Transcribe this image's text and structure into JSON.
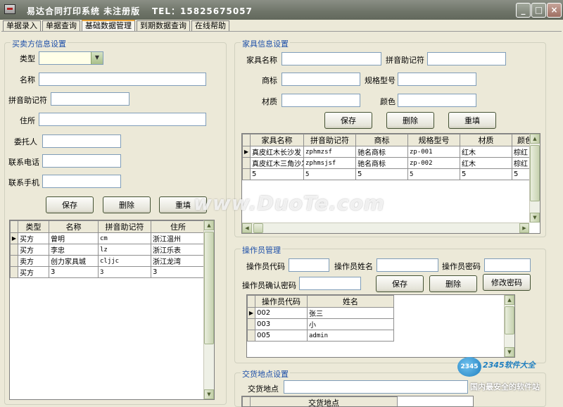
{
  "window": {
    "title": "易达合同打印系统 未注册版",
    "tel": "TEL：15825675057",
    "minimize_glyph": "_",
    "maximize_glyph": "□",
    "close_glyph": "×"
  },
  "tabs": [
    {
      "label": "单据录入",
      "active": false
    },
    {
      "label": "单据查询",
      "active": false
    },
    {
      "label": "基础数据管理",
      "active": true
    },
    {
      "label": "到期数据查询",
      "active": false
    },
    {
      "label": "在线帮助",
      "active": false
    }
  ],
  "party_panel": {
    "title": "买卖方信息设置",
    "type_label": "类型",
    "type_value": "",
    "name_label": "名称",
    "pinyin_label": "拼音助记符",
    "address_label": "住所",
    "agent_label": "委托人",
    "phone_label": "联系电话",
    "mobile_label": "联系手机",
    "save": "保存",
    "delete": "删除",
    "reset": "重填",
    "columns": [
      "类型",
      "名称",
      "拼音助记符",
      "住所"
    ],
    "rows": [
      [
        "买方",
        "曾明",
        "cm",
        "浙江温州"
      ],
      [
        "买方",
        "李忠",
        "lz",
        "浙江乐表"
      ],
      [
        "卖方",
        "创力家具城",
        "cljjc",
        "浙江龙湾"
      ],
      [
        "买方",
        "3",
        "3",
        "3"
      ]
    ]
  },
  "furniture_panel": {
    "title": "家具信息设置",
    "name_label": "家具名称",
    "pinyin_label": "拼音助记符",
    "brand_label": "商标",
    "spec_label": "规格型号",
    "material_label": "材质",
    "color_label": "颜色",
    "save": "保存",
    "delete": "删除",
    "reset": "重填",
    "columns": [
      "家具名称",
      "拼音助记符",
      "商标",
      "规格型号",
      "材质",
      "颜色"
    ],
    "rows": [
      [
        "真皮红木长沙发",
        "zphmzsf",
        "驰名商标",
        "zp-001",
        "红木",
        "棕红"
      ],
      [
        "真皮红木三角沙发",
        "zphmsjsf",
        "驰名商标",
        "zp-002",
        "红木",
        "棕红"
      ],
      [
        "5",
        "5",
        "5",
        "5",
        "5",
        "5"
      ]
    ]
  },
  "operator_panel": {
    "title": "操作员管理",
    "code_label": "操作员代码",
    "name_label": "操作员姓名",
    "password_label": "操作员密码",
    "confirm_label": "操作员确认密码",
    "save": "保存",
    "delete": "删除",
    "change_password": "修改密码",
    "columns": [
      "操作员代码",
      "姓名"
    ],
    "rows": [
      [
        "002",
        "张三"
      ],
      [
        "003",
        "小"
      ],
      [
        "005",
        "admin"
      ]
    ]
  },
  "delivery_panel": {
    "title": "交货地点设置",
    "place_label": "交货地点",
    "columns": [
      "交货地点"
    ]
  },
  "watermark": "www.DuoTe.com",
  "logo": {
    "mark": "2345",
    "text": "2345软件大全",
    "sub": "国内最安全的软件站"
  },
  "colors": {
    "accent_title": "#1c4ea8",
    "window_bg": "#ece9d8",
    "titlebar": "#6e7468"
  }
}
